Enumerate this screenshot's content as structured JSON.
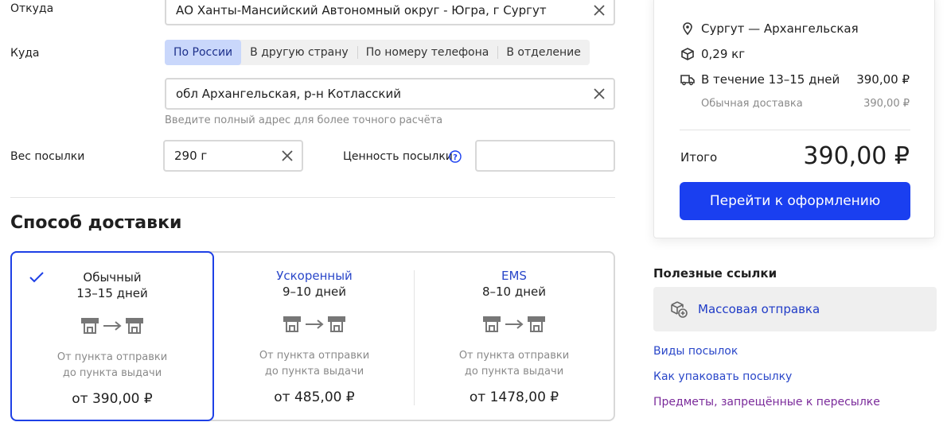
{
  "form": {
    "from_label": "Откуда",
    "from_value": "АО Ханты-Мансийский Автономный округ - Югра, г Сургут",
    "to_label": "Куда",
    "to_tabs": [
      "По России",
      "В другую страну",
      "По номеру телефона",
      "В отделение"
    ],
    "to_tab_active": "По России",
    "to_value": "обл Архангельская, р-н Котласский",
    "to_hint": "Введите полный адрес для более точного расчёта",
    "weight_label": "Вес посылки",
    "weight_value": "290 г",
    "value_label": "Ценность посылки",
    "value_value": ""
  },
  "delivery": {
    "title": "Способ доставки",
    "options": [
      {
        "name": "Обычный",
        "days": "13–15 дней",
        "desc1": "От пункта отправки",
        "desc2": "до пункта выдачи",
        "price": "от 390,00 ₽",
        "selected": true
      },
      {
        "name": "Ускоренный",
        "days": "9–10 дней",
        "desc1": "От пункта отправки",
        "desc2": "до пункта выдачи",
        "price": "от 485,00 ₽",
        "selected": false
      },
      {
        "name": "EMS",
        "days": "8–10 дней",
        "desc1": "От пункта отправки",
        "desc2": "до пункта выдачи",
        "price": "от 1478,00 ₽",
        "selected": false
      }
    ]
  },
  "summary": {
    "route": "Сургут — Архангельская",
    "weight": "0,29 кг",
    "term": "В течение 13–15 дней",
    "term_price": "390,00 ₽",
    "type": "Обычная доставка",
    "type_price": "390,00 ₽",
    "total_label": "Итого",
    "total_value": "390,00 ₽",
    "cta": "Перейти к оформлению"
  },
  "links": {
    "title": "Полезные ссылки",
    "mass": "Массовая отправка",
    "items": [
      "Виды посылок",
      "Как упаковать посылку",
      "Предметы, запрещённые к пересылке"
    ]
  },
  "colors": {
    "accent": "#1a3ff0",
    "selected_border": "#1e40e6",
    "link": "#2a47c9",
    "link_visited": "#7a2a9a",
    "tab_active_bg": "#c9d7fb"
  }
}
